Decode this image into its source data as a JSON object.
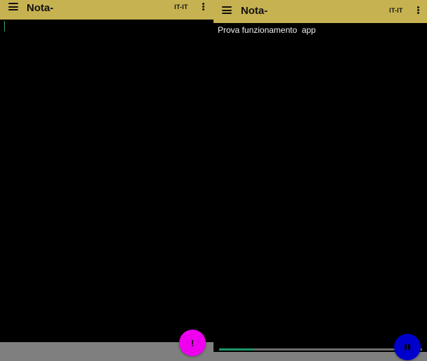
{
  "colors": {
    "appbar": "#c6b250",
    "background": "#000000",
    "fab_left": "#ee00ee",
    "fab_right": "#0000cc",
    "progress": "#1b9a6a",
    "bottom_bar": "#7f7f7f"
  },
  "left": {
    "title": "Nota-",
    "language": "IT-IT",
    "menu_icon": "hamburger-menu-icon",
    "more_icon": "more-vert-icon",
    "fab_icon": "exclamation-icon",
    "fab_label": "!"
  },
  "right": {
    "title": "Nota-",
    "language": "IT-IT",
    "menu_icon": "hamburger-menu-icon",
    "more_icon": "more-vert-icon",
    "editor_text": "Prova funzionamento  app",
    "progress_fraction": 0.17,
    "fab_icon": "pause-icon"
  }
}
